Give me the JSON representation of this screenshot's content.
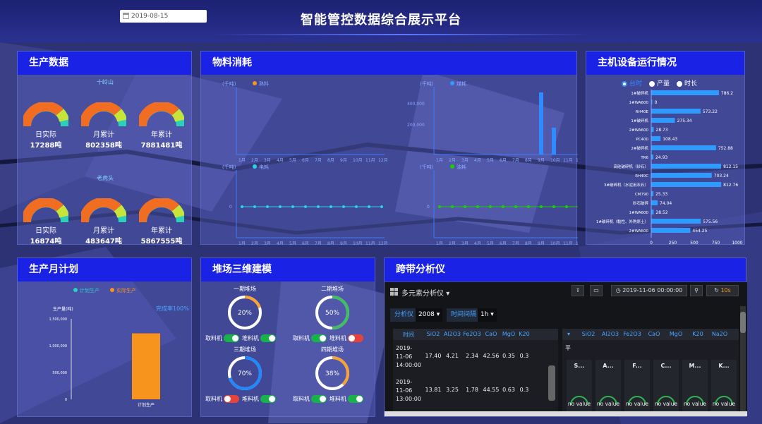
{
  "header": {
    "date": "2019-08-15",
    "title": "智能管控数据综合展示平台"
  },
  "production": {
    "title": "生产数据",
    "groups": [
      {
        "name": "十岭山",
        "items": [
          {
            "label": "日实际",
            "value": "17288吨"
          },
          {
            "label": "月累计",
            "value": "802358吨"
          },
          {
            "label": "年累计",
            "value": "7881481吨"
          }
        ]
      },
      {
        "name": "老虎头",
        "items": [
          {
            "label": "日实际",
            "value": "16874吨"
          },
          {
            "label": "月累计",
            "value": "483647吨"
          },
          {
            "label": "年累计",
            "value": "5867555吨"
          }
        ]
      }
    ]
  },
  "material": {
    "title": "物料消耗",
    "charts": [
      {
        "unit": "(千吨)",
        "legend": "熟料"
      },
      {
        "unit": "(千吨)",
        "legend": "煤耗",
        "yticks": [
          "400,000",
          "200,000"
        ]
      },
      {
        "unit": "(千吨)",
        "legend": "电耗",
        "y0": "0"
      },
      {
        "unit": "(千吨)",
        "legend": "油耗",
        "y0": "0"
      }
    ],
    "months": [
      "1月",
      "2月",
      "3月",
      "4月",
      "5月",
      "6月",
      "7月",
      "8月",
      "9月",
      "10月",
      "11月",
      "12月"
    ]
  },
  "equipment": {
    "title": "主机设备运行情况",
    "radios": [
      {
        "label": "台时",
        "checked": true
      },
      {
        "label": "产量",
        "checked": false
      },
      {
        "label": "时长",
        "checked": false
      }
    ],
    "rows": [
      {
        "name": "1#破碎机",
        "value": "786.2",
        "num": 786.2
      },
      {
        "name": "1#WA600",
        "value": "0",
        "num": 0
      },
      {
        "name": "RH40E",
        "value": "573.22",
        "num": 573.22
      },
      {
        "name": "1#破碎机",
        "value": "275.34",
        "num": 275.34
      },
      {
        "name": "2#WA600",
        "value": "28.73",
        "num": 28.73
      },
      {
        "name": "PC400",
        "value": "108.43",
        "num": 108.43
      },
      {
        "name": "2#破碎机",
        "value": "752.88",
        "num": 752.88
      },
      {
        "name": "TR6",
        "value": "24.93",
        "num": 24.93
      },
      {
        "name": "高硅破碎机（砂石）",
        "value": "812.15",
        "num": 812.15
      },
      {
        "name": "RH40C",
        "value": "703.24",
        "num": 703.24
      },
      {
        "name": "3#破碎机（水泥用灰石）",
        "value": "812.76",
        "num": 812.76
      },
      {
        "name": "CM790",
        "value": "25.33",
        "num": 25.33
      },
      {
        "name": "砂石破碎",
        "value": "74.04",
        "num": 74.04
      },
      {
        "name": "1#WA600",
        "value": "28.52",
        "num": 28.52
      },
      {
        "name": "1#破碎机（黏性、外购原土）",
        "value": "575.56",
        "num": 575.56
      },
      {
        "name": "2#WA600",
        "value": "454.25",
        "num": 454.25
      }
    ],
    "xticks": [
      "0",
      "250",
      "500",
      "750",
      "1000"
    ],
    "xmax": 1000
  },
  "monthly": {
    "title": "生产月计划",
    "legend": [
      "计划生产",
      "实际生产"
    ],
    "ylabel": "生产量(吨)",
    "rate": "完成率100%",
    "yticks": [
      "1,500,000",
      "1,000,000",
      "500,000",
      "0"
    ],
    "xlabel": "计划生产",
    "plan": 1230000,
    "ymax": 1500000
  },
  "yard": {
    "title": "堆场三维建模",
    "items": [
      {
        "name": "一期堆场",
        "pct": "20%",
        "frac": 0.2,
        "take": "取料机",
        "take_on": true,
        "pile": "堆料机",
        "pile_on": true
      },
      {
        "name": "二期堆场",
        "pct": "50%",
        "frac": 0.5,
        "take": "取料机",
        "take_on": true,
        "pile": "堆料机",
        "pile_on": false
      },
      {
        "name": "三期堆场",
        "pct": "70%",
        "frac": 0.7,
        "take": "取料机",
        "take_on": false,
        "pile": "堆料机",
        "pile_on": true
      },
      {
        "name": "四期堆场",
        "pct": "38%",
        "frac": 0.38,
        "take": "取料机",
        "take_on": true,
        "pile": "堆料机",
        "pile_on": true
      }
    ]
  },
  "analyzer": {
    "title": "跨带分析仪",
    "dash": "多元素分析仪",
    "time_range": "2019-11-06 00:00:00",
    "refresh": "10s",
    "analyzer_label": "分析仪",
    "analyzer_value": "2008",
    "interval_label": "时间间隔",
    "interval_value": "1h",
    "cols": [
      "时间",
      "SiO2",
      "Al2O3",
      "Fe2O3",
      "CaO",
      "MgO",
      "K20"
    ],
    "rows": [
      {
        "time": "2019-11-06 14:00:00",
        "v": [
          "17.40",
          "4.21",
          "2.34",
          "42.56",
          "0.35",
          "0.3"
        ]
      },
      {
        "time": "2019-11-06 13:00:00",
        "v": [
          "13.81",
          "3.25",
          "1.78",
          "44.55",
          "0.63",
          "0.3"
        ]
      }
    ],
    "avg_label": "平",
    "cols2": [
      "SiO2",
      "Al2O3",
      "Fe2O3",
      "CaO",
      "MgO",
      "K20",
      "Na2O"
    ],
    "cards": [
      "S...",
      "A...",
      "F...",
      "C...",
      "M...",
      "K..."
    ],
    "novalue": "no value"
  }
}
